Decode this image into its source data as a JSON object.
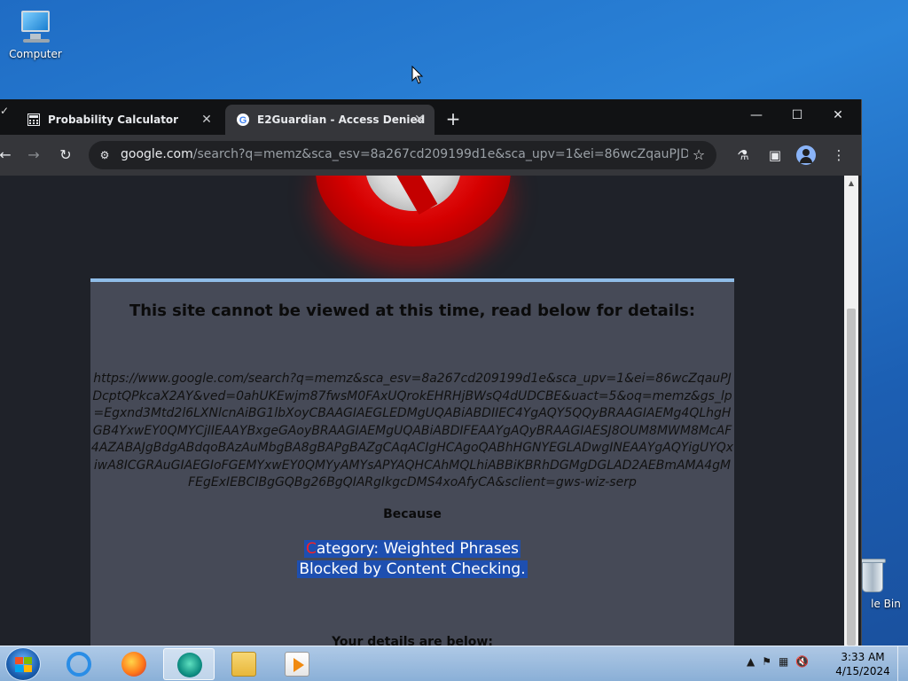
{
  "desktop": {
    "icons": [
      {
        "label": "Computer",
        "icon": "computer-icon"
      },
      {
        "label": "le Bin",
        "icon": "recycle-bin-icon"
      }
    ]
  },
  "browser": {
    "tabs": [
      {
        "title": "Probability Calculator",
        "icon": "calculator-icon"
      },
      {
        "title": "E2Guardian - Access Denied",
        "icon": "google-icon"
      }
    ],
    "new_tab": "+",
    "window_controls": {
      "minimize": "—",
      "maximize": "☐",
      "close": "✕"
    },
    "nav": {
      "back": "←",
      "forward": "→",
      "reload": "↻"
    },
    "address": {
      "host": "google.com",
      "path": "/search?q=memz&sca_esv=8a267cd209199d1e&sca_upv=1&ei=86wcZqauPJDcptQPkcaX..."
    }
  },
  "page": {
    "title": "This site cannot be viewed at this time, read below for details:",
    "blocked_url": "https://www.google.com/search?q=memz&sca_esv=8a267cd209199d1e&sca_upv=1&ei=86wcZqauPJDcptQPkcaX2AY&ved=0ahUKEwjm87fwsM0FAxUQrokEHRHjBWsQ4dUDCBE&uact=5&oq=memz&gs_lp=Egxnd3Mtd2l6LXNlcnAiBG1lbXoyCBAAGIAEGLEDMgUQABiABDIIEC4YgAQY5QQyBRAAGIAEMg4QLhgHGB4YxwEY0QMYCjIIEAAYBxgeGAoyBRAAGIAEMgUQABiABDIFEAAYgAQyBRAAGIAESJ8OUM8MWM8McAF4AZABAJgBdgABdqoBAzAuMbgBA8gBAPgBAZgCAqACIgHCAgoQABhHGNYEGLADwgINEAAYgAQYigUYQxiwA8ICGRAuGIAEGIoFGEMYxwEY0QMYyAMYsAPYAQHCAhMQLhiABBiKBRhDGMgDGLAD2AEBmAMA4gMFEgExIEBCIBgGQBg26BgQIARgIkgcDMS4xoAfyCA&sclient=gws-wiz-serp",
    "because_label": "Because",
    "reason_line1_first": "C",
    "reason_line1_rest": "ategory: Weighted Phrases",
    "reason_line2": "Blocked by Content Checking.",
    "details_label": "Your details are below:"
  },
  "taskbar": {
    "apps": [
      "internet-explorer-icon",
      "firefox-icon",
      "edge-icon",
      "folder-icon",
      "media-player-icon"
    ],
    "clock_time": "3:33 AM",
    "clock_date": "4/15/2024"
  }
}
